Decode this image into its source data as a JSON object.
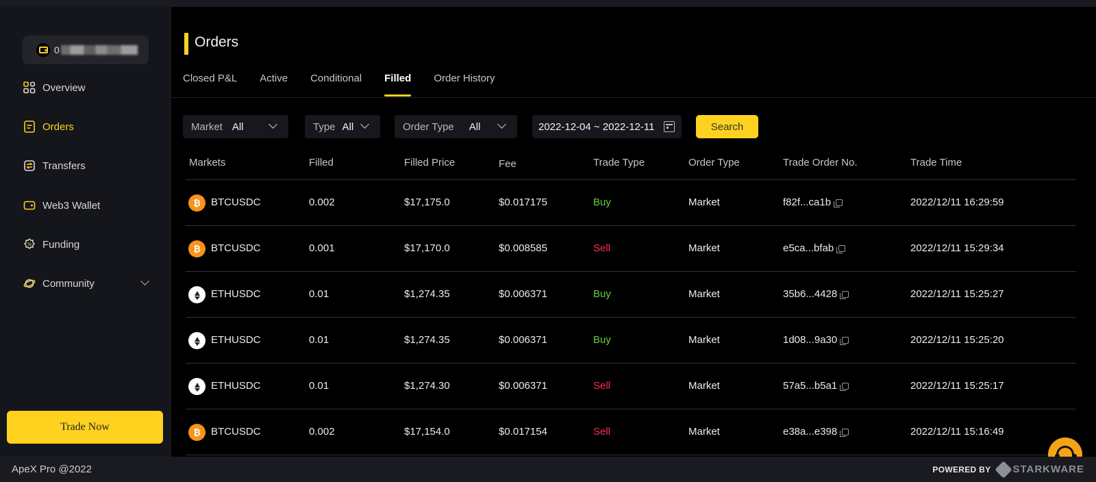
{
  "sidebar": {
    "wallet_prefix": "0",
    "nav": [
      {
        "label": "Overview",
        "icon": "grid-icon"
      },
      {
        "label": "Orders",
        "icon": "document-icon"
      },
      {
        "label": "Transfers",
        "icon": "transfer-icon"
      },
      {
        "label": "Web3 Wallet",
        "icon": "wallet-icon"
      },
      {
        "label": "Funding",
        "icon": "funding-icon"
      },
      {
        "label": "Community",
        "icon": "planet-icon"
      }
    ],
    "trade_now": "Trade Now"
  },
  "page": {
    "title": "Orders"
  },
  "tabs": [
    "Closed P&L",
    "Active",
    "Conditional",
    "Filled",
    "Order History"
  ],
  "filters": {
    "market_label": "Market",
    "market_value": "All",
    "type_label": "Type",
    "type_value": "All",
    "order_type_label": "Order Type",
    "order_type_value": "All",
    "date_range": "2022-12-04 ~ 2022-12-11",
    "search": "Search"
  },
  "table": {
    "headers": [
      "Markets",
      "Filled",
      "Filled Price",
      "Fee",
      "Trade Type",
      "Order Type",
      "Trade Order No.",
      "Trade Time"
    ],
    "rows": [
      {
        "coin": "btc",
        "market": "BTCUSDC",
        "filled": "0.002",
        "price": "$17,175.0",
        "fee": "$0.017175",
        "trade_type": "Buy",
        "order_type": "Market",
        "order_no": "f82f...ca1b",
        "time": "2022/12/11 16:29:59"
      },
      {
        "coin": "btc",
        "market": "BTCUSDC",
        "filled": "0.001",
        "price": "$17,170.0",
        "fee": "$0.008585",
        "trade_type": "Sell",
        "order_type": "Market",
        "order_no": "e5ca...bfab",
        "time": "2022/12/11 15:29:34"
      },
      {
        "coin": "eth",
        "market": "ETHUSDC",
        "filled": "0.01",
        "price": "$1,274.35",
        "fee": "$0.006371",
        "trade_type": "Buy",
        "order_type": "Market",
        "order_no": "35b6...4428",
        "time": "2022/12/11 15:25:27"
      },
      {
        "coin": "eth",
        "market": "ETHUSDC",
        "filled": "0.01",
        "price": "$1,274.35",
        "fee": "$0.006371",
        "trade_type": "Buy",
        "order_type": "Market",
        "order_no": "1d08...9a30",
        "time": "2022/12/11 15:25:20"
      },
      {
        "coin": "eth",
        "market": "ETHUSDC",
        "filled": "0.01",
        "price": "$1,274.30",
        "fee": "$0.006371",
        "trade_type": "Sell",
        "order_type": "Market",
        "order_no": "57a5...b5a1",
        "time": "2022/12/11 15:25:17"
      },
      {
        "coin": "btc",
        "market": "BTCUSDC",
        "filled": "0.002",
        "price": "$17,154.0",
        "fee": "$0.017154",
        "trade_type": "Sell",
        "order_type": "Market",
        "order_no": "e38a...e398",
        "time": "2022/12/11 15:16:49"
      }
    ]
  },
  "footer": {
    "copyright": "ApeX Pro @2022",
    "powered_by": "POWERED BY",
    "partner": "STARKWARE"
  },
  "colors": {
    "accent": "#ffd21f",
    "buy": "#5fd33c",
    "sell": "#ff2a58"
  }
}
